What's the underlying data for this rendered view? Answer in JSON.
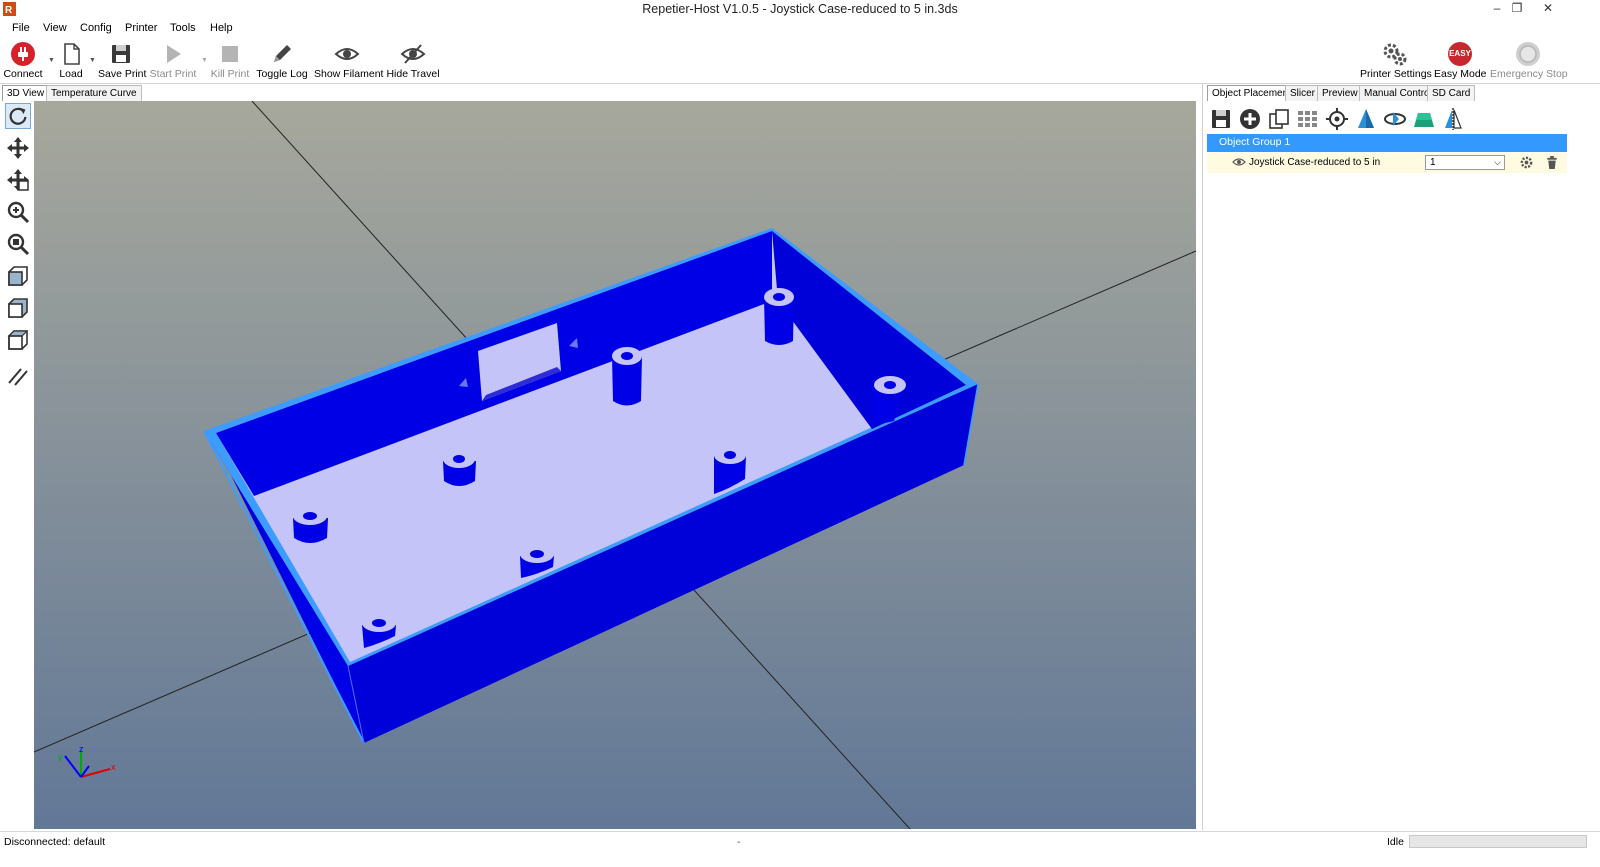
{
  "window": {
    "title": "Repetier-Host V1.0.5 - Joystick Case-reduced to 5 in.3ds",
    "minimize": "–",
    "maximize": "❐",
    "close": "✕"
  },
  "menu": [
    "File",
    "View",
    "Config",
    "Printer",
    "Tools",
    "Help"
  ],
  "toolbar": {
    "connect": "Connect",
    "load": "Load",
    "save_print": "Save Print",
    "start_print": "Start Print",
    "kill_print": "Kill Print",
    "toggle_log": "Toggle Log",
    "show_filament": "Show Filament",
    "hide_travel": "Hide Travel",
    "printer_settings": "Printer Settings",
    "easy_mode": "Easy Mode",
    "easy_badge": "EASY",
    "emergency_stop": "Emergency Stop"
  },
  "left_tabs": [
    "3D View",
    "Temperature Curve"
  ],
  "right_tabs": [
    "Object Placement",
    "Slicer",
    "Preview",
    "Manual Control",
    "SD Card"
  ],
  "object_list": {
    "group_name": "Object Group 1",
    "object_name": "Joystick Case-reduced to 5 in",
    "copies": "1"
  },
  "axes": {
    "x": "x",
    "y": "y",
    "z": "z"
  },
  "status": {
    "connection": "Disconnected: default",
    "middle": "-",
    "state": "Idle",
    "progress": 0
  },
  "colors": {
    "model_blue": "#0000e6",
    "model_floor": "#c4c4f8",
    "edge_highlight": "#3c9cff",
    "selection": "#3399ff",
    "viewport_top": "#a7a89c",
    "viewport_bottom": "#627897"
  }
}
